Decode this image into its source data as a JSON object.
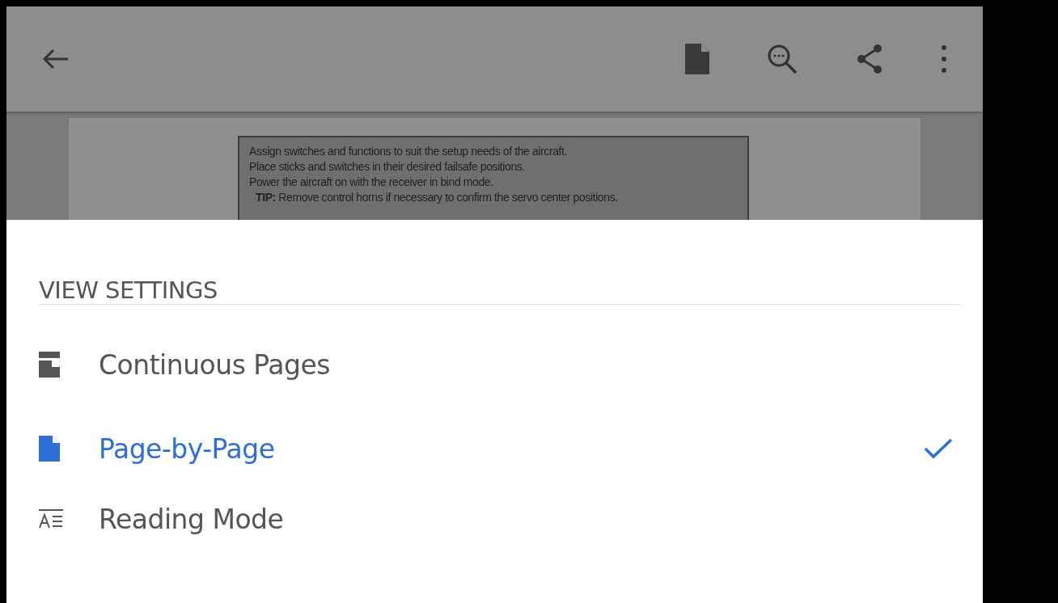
{
  "document": {
    "lines": [
      "Assign switches and functions to suit the setup needs of the aircraft.",
      "Place sticks and switches in their desired failsafe positions.",
      "Power the aircraft on with the receiver in bind mode.",
      "**TIP:** Remove control horns if necessary to confirm the servo center positions."
    ]
  },
  "sheet": {
    "title": "VIEW SETTINGS",
    "options": [
      {
        "kind": "continuous",
        "label": "Continuous Pages",
        "selected": false
      },
      {
        "kind": "page",
        "label": "Page-by-Page",
        "selected": true
      },
      {
        "kind": "reading",
        "label": "Reading Mode",
        "selected": false
      }
    ]
  }
}
